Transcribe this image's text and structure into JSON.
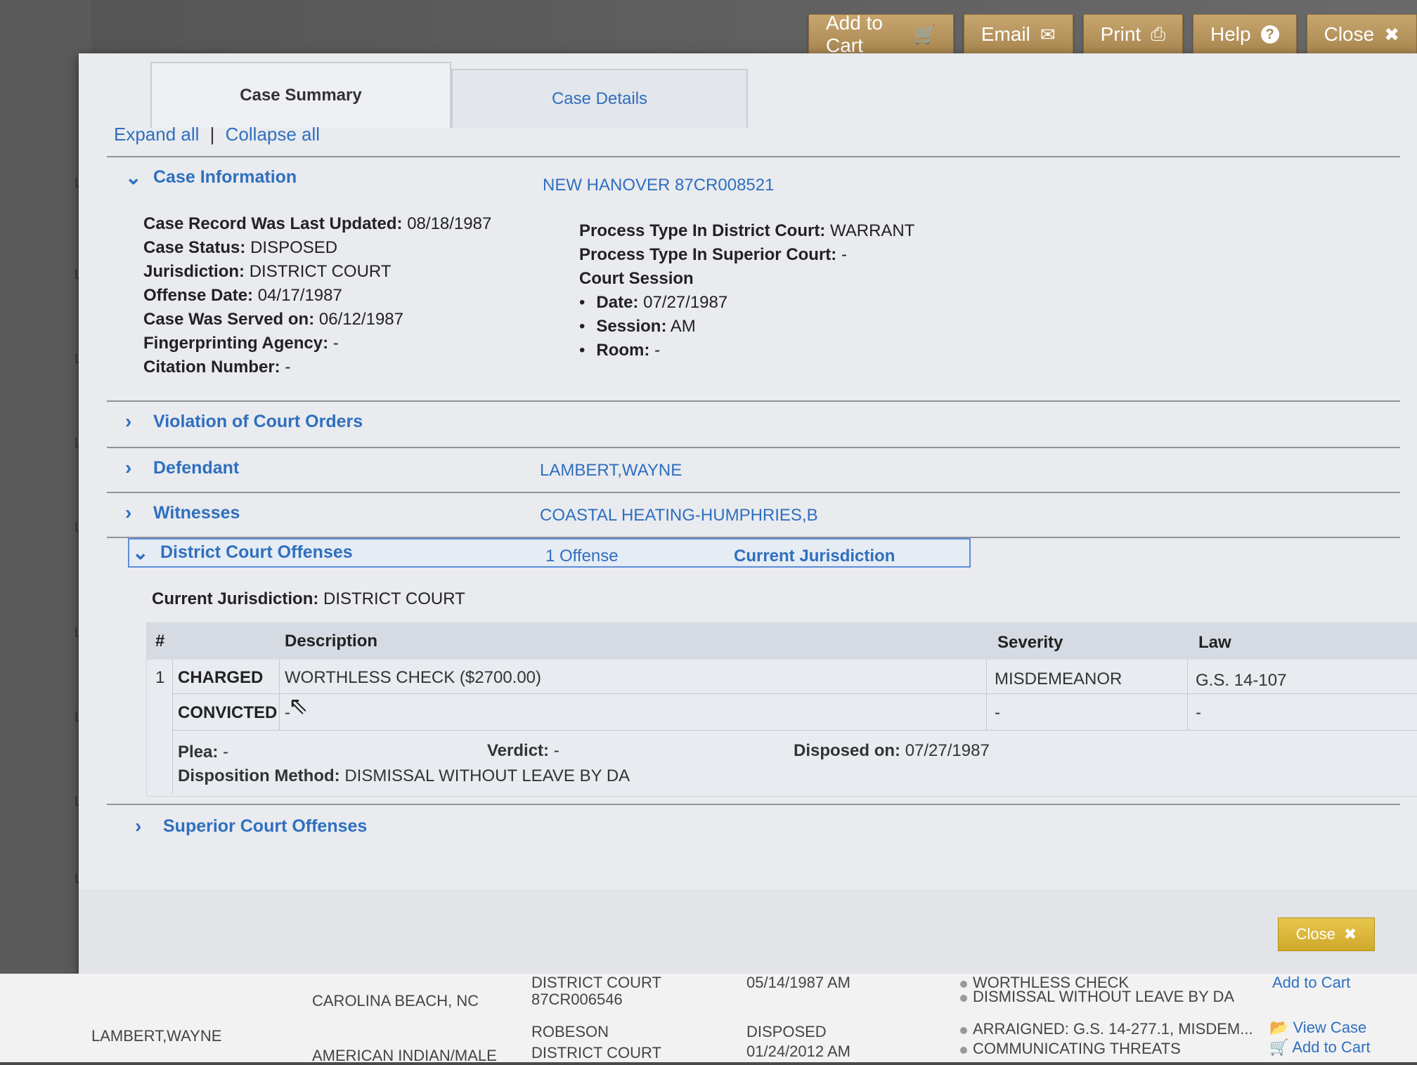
{
  "toolbar": {
    "add_to_cart": "Add to Cart",
    "email": "Email",
    "print": "Print",
    "help": "Help",
    "close": "Close"
  },
  "tabs": {
    "case_summary": "Case Summary",
    "case_details": "Case Details"
  },
  "expand": {
    "expand_all": "Expand all",
    "sep": "|",
    "collapse_all": "Collapse all"
  },
  "case_info": {
    "heading": "Case Information",
    "case_id": "NEW HANOVER 87CR008521",
    "left": [
      {
        "label": "Case Record Was Last Updated:",
        "value": "08/18/1987"
      },
      {
        "label": "Case Status:",
        "value": "DISPOSED"
      },
      {
        "label": "Jurisdiction:",
        "value": "DISTRICT COURT"
      },
      {
        "label": "Offense Date:",
        "value": "04/17/1987"
      },
      {
        "label": "Case Was Served on:",
        "value": "06/12/1987"
      },
      {
        "label": "Fingerprinting Agency:",
        "value": "-"
      },
      {
        "label": "Citation Number:",
        "value": "-"
      }
    ],
    "right": {
      "process_district_label": "Process Type In District Court:",
      "process_district_value": "WARRANT",
      "process_superior_label": "Process Type In Superior Court:",
      "process_superior_value": "-",
      "court_session": "Court Session",
      "date_label": "Date:",
      "date_value": "07/27/1987",
      "session_label": "Session:",
      "session_value": "AM",
      "room_label": "Room:",
      "room_value": "-"
    }
  },
  "sections": {
    "violation": "Violation of Court Orders",
    "defendant": "Defendant",
    "defendant_value": "LAMBERT,WAYNE",
    "witnesses": "Witnesses",
    "witnesses_value": "COASTAL HEATING-HUMPHRIES,B",
    "district_offenses": "District Court Offenses",
    "offense_count": "1 Offense",
    "current_jurisdiction_link": "Current Jurisdiction",
    "superior_offenses": "Superior Court Offenses"
  },
  "offenses": {
    "current_jurisdiction_label": "Current Jurisdiction:",
    "current_jurisdiction_value": "DISTRICT COURT",
    "headers": {
      "num": "#",
      "description": "Description",
      "severity": "Severity",
      "law": "Law"
    },
    "row_num": "1",
    "charged_label": "CHARGED",
    "charged_desc": "WORTHLESS CHECK ($2700.00)",
    "charged_severity": "MISDEMEANOR",
    "charged_law": "G.S. 14-107",
    "convicted_label": "CONVICTED",
    "convicted_desc": "-",
    "convicted_severity": "-",
    "convicted_law": "-",
    "plea_label": "Plea:",
    "plea_value": "-",
    "verdict_label": "Verdict:",
    "verdict_value": "-",
    "disposed_label": "Disposed on:",
    "disposed_value": "07/27/1987",
    "disposition_label": "Disposition Method:",
    "disposition_value": "DISMISSAL WITHOUT LEAVE BY DA"
  },
  "footer": {
    "close": "Close"
  },
  "background": {
    "r1_court": "DISTRICT COURT",
    "r1_date": "05/14/1987 AM",
    "r1_offense": "WORTHLESS CHECK",
    "r1_add": "Add to Cart",
    "r2_location": "CAROLINA BEACH, NC",
    "r2_case": "87CR006546",
    "r2_disposition": "DISMISSAL WITHOUT LEAVE BY DA",
    "r3_name": "LAMBERT,WAYNE",
    "r3_county": "ROBESON",
    "r3_status": "DISPOSED",
    "r3_arraigned": "ARRAIGNED: G.S. 14-277.1, MISDEM...",
    "r3_view": "View Case",
    "r4_race": "AMERICAN INDIAN/MALE",
    "r4_court": "DISTRICT COURT",
    "r4_date": "01/24/2012 AM",
    "r4_offense": "COMMUNICATING THREATS",
    "r4_add": "Add to Cart"
  }
}
